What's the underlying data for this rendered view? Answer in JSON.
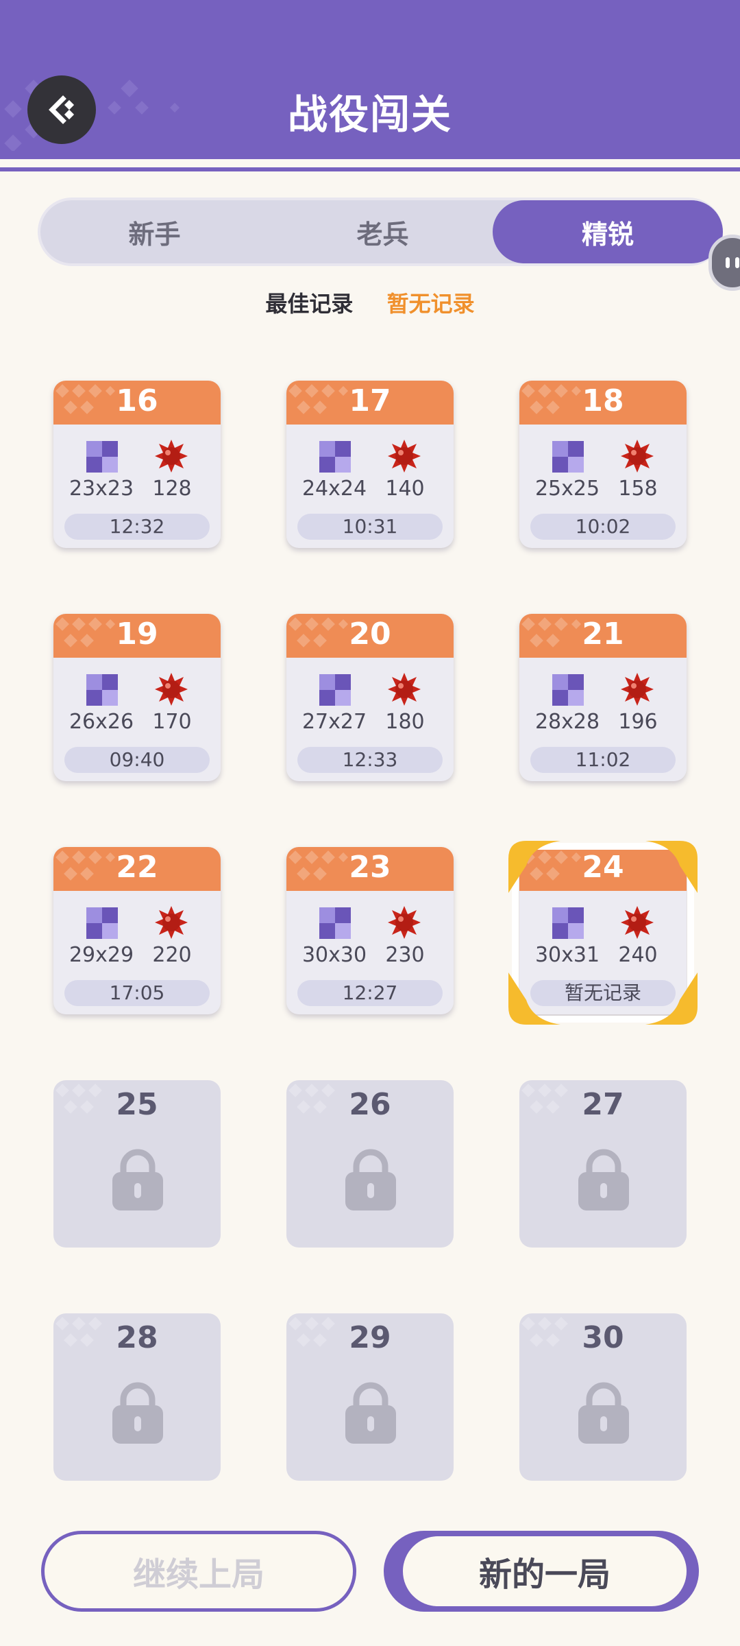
{
  "header": {
    "title": "战役闯关"
  },
  "tabs": [
    {
      "label": "新手",
      "active": false
    },
    {
      "label": "老兵",
      "active": false
    },
    {
      "label": "精锐",
      "active": true
    }
  ],
  "record": {
    "label": "最佳记录",
    "value": "暂无记录"
  },
  "levels": [
    {
      "num": "16",
      "size": "23x23",
      "mines": "128",
      "time": "12:32"
    },
    {
      "num": "17",
      "size": "24x24",
      "mines": "140",
      "time": "10:31"
    },
    {
      "num": "18",
      "size": "25x25",
      "mines": "158",
      "time": "10:02"
    },
    {
      "num": "19",
      "size": "26x26",
      "mines": "170",
      "time": "09:40"
    },
    {
      "num": "20",
      "size": "27x27",
      "mines": "180",
      "time": "12:33"
    },
    {
      "num": "21",
      "size": "28x28",
      "mines": "196",
      "time": "11:02"
    },
    {
      "num": "22",
      "size": "29x29",
      "mines": "220",
      "time": "17:05"
    },
    {
      "num": "23",
      "size": "30x30",
      "mines": "230",
      "time": "12:27"
    },
    {
      "num": "24",
      "size": "30x31",
      "mines": "240",
      "time": "暂无记录",
      "selected": true
    }
  ],
  "locked_levels": [
    "25",
    "26",
    "27",
    "28",
    "29",
    "30"
  ],
  "buttons": {
    "continue": "继续上局",
    "new_game": "新的一局"
  },
  "colors": {
    "primary": "#7661bf",
    "card_header": "#ef8c55",
    "record_value": "#f0902c",
    "selection": "#f6bb2d"
  },
  "icons": {
    "back": "back-arrow-icon",
    "grid": "grid-icon",
    "mine": "mine-icon",
    "lock": "lock-icon"
  }
}
